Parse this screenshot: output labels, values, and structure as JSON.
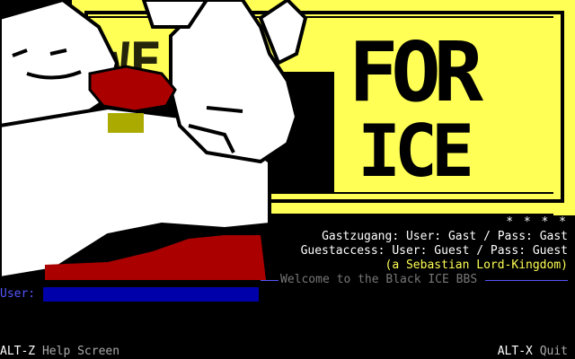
{
  "banner": {
    "title_line1": "FOR",
    "title_line2": "ICE",
    "partial_word": "WE"
  },
  "login_info": {
    "stars": "* * * *",
    "gast_line": "Gastzugang: User: Gast / Pass: Gast",
    "guest_line": "Guestaccess: User: Guest / Pass: Guest",
    "credit_line": "(a Sebastian Lord-Kingdom)",
    "welcome_line": "Welcome to the Black ICE BBS"
  },
  "login": {
    "user_label": "User:",
    "user_value": ""
  },
  "footer": {
    "help_key": "ALT-Z",
    "help_label": "Help Screen",
    "quit_key": "ALT-X",
    "quit_label": "Quit"
  },
  "colors": {
    "yellow": "#ffff55",
    "dark_yellow": "#555500",
    "red": "#aa0000",
    "white": "#ffffff",
    "blue": "#0000aa",
    "light_blue": "#5555ff"
  }
}
